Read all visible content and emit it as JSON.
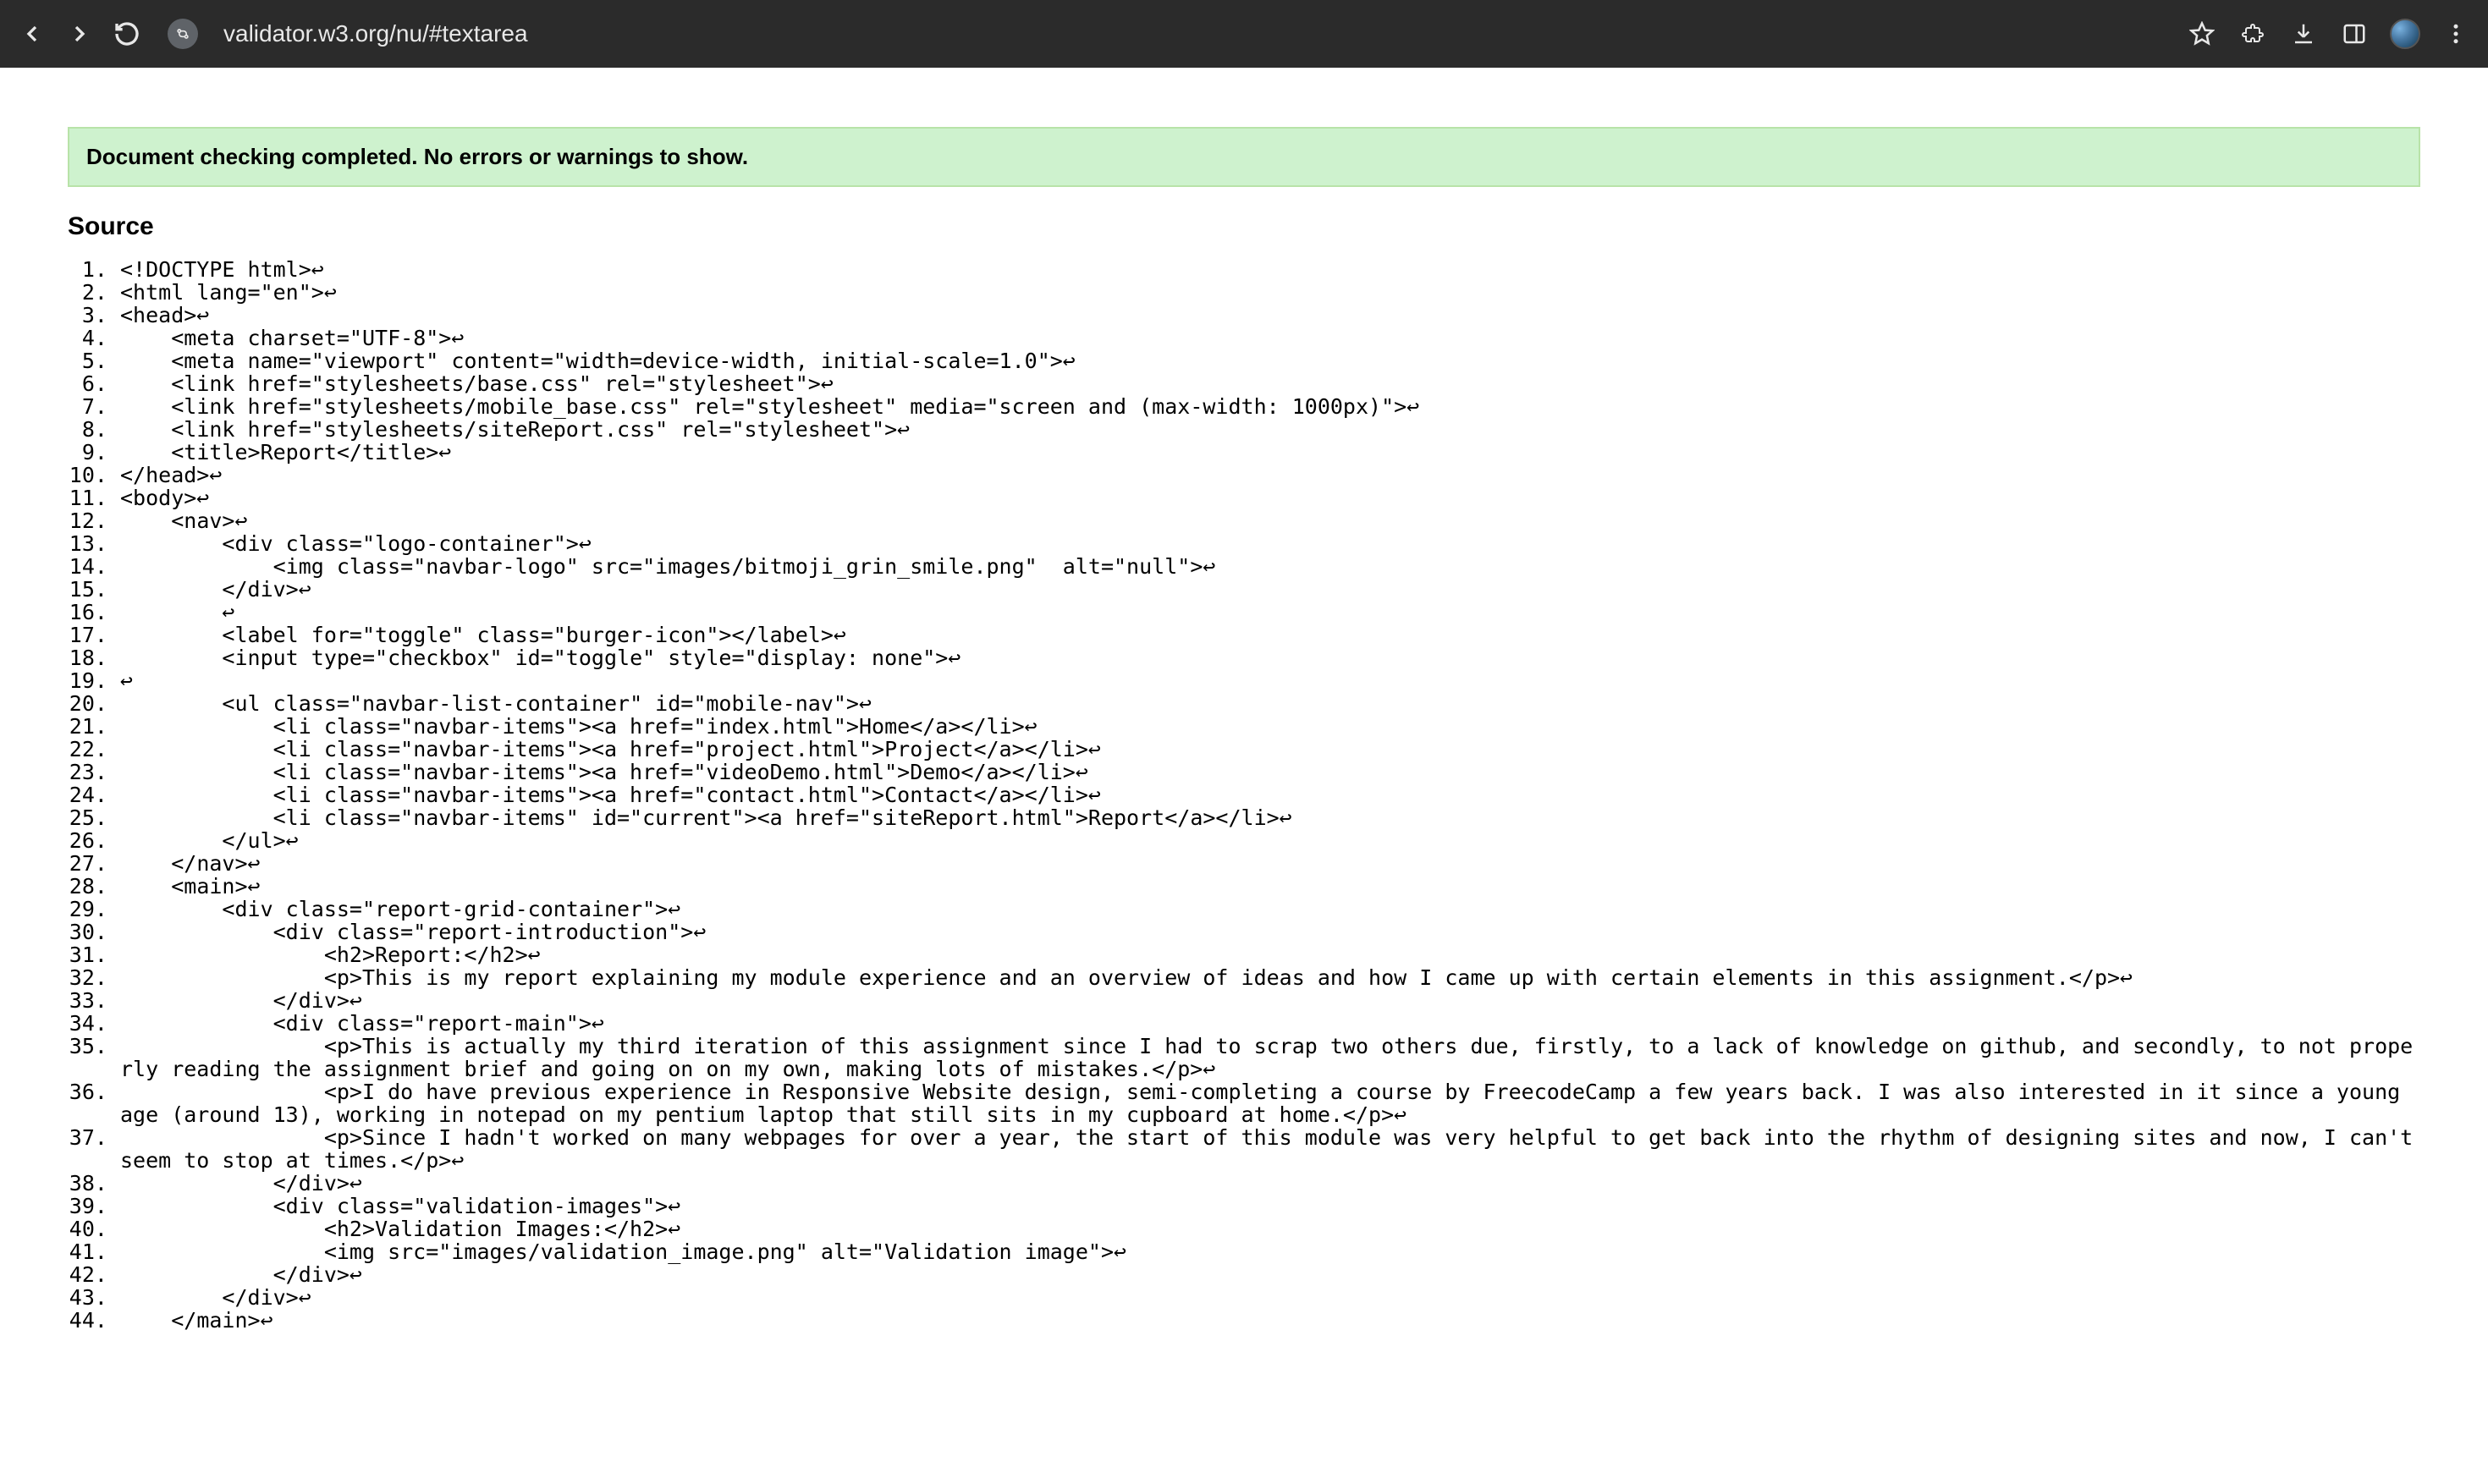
{
  "browser": {
    "url": "validator.w3.org/nu/#textarea"
  },
  "validator": {
    "success_message": "Document checking completed. No errors or warnings to show.",
    "source_heading": "Source",
    "source_lines": [
      "<!DOCTYPE html>↩",
      "<html lang=\"en\">↩",
      "<head>↩",
      "    <meta charset=\"UTF-8\">↩",
      "    <meta name=\"viewport\" content=\"width=device-width, initial-scale=1.0\">↩",
      "    <link href=\"stylesheets/base.css\" rel=\"stylesheet\">↩",
      "    <link href=\"stylesheets/mobile_base.css\" rel=\"stylesheet\" media=\"screen and (max-width: 1000px)\">↩",
      "    <link href=\"stylesheets/siteReport.css\" rel=\"stylesheet\">↩",
      "    <title>Report</title>↩",
      "</head>↩",
      "<body>↩",
      "    <nav>↩",
      "        <div class=\"logo-container\">↩",
      "            <img class=\"navbar-logo\" src=\"images/bitmoji_grin_smile.png\"  alt=\"null\">↩",
      "        </div>↩",
      "        ↩",
      "        <label for=\"toggle\" class=\"burger-icon\"></label>↩",
      "        <input type=\"checkbox\" id=\"toggle\" style=\"display: none\">↩",
      "↩",
      "        <ul class=\"navbar-list-container\" id=\"mobile-nav\">↩",
      "            <li class=\"navbar-items\"><a href=\"index.html\">Home</a></li>↩",
      "            <li class=\"navbar-items\"><a href=\"project.html\">Project</a></li>↩",
      "            <li class=\"navbar-items\"><a href=\"videoDemo.html\">Demo</a></li>↩",
      "            <li class=\"navbar-items\"><a href=\"contact.html\">Contact</a></li>↩",
      "            <li class=\"navbar-items\" id=\"current\"><a href=\"siteReport.html\">Report</a></li>↩",
      "        </ul>↩",
      "    </nav>↩",
      "    <main>↩",
      "        <div class=\"report-grid-container\">↩",
      "            <div class=\"report-introduction\">↩",
      "                <h2>Report:</h2>↩",
      "                <p>This is my report explaining my module experience and an overview of ideas and how I came up with certain elements in this assignment.</p>↩",
      "            </div>↩",
      "            <div class=\"report-main\">↩",
      "                <p>This is actually my third iteration of this assignment since I had to scrap two others due, firstly, to a lack of knowledge on github, and secondly, to not properly reading the assignment brief and going on on my own, making lots of mistakes.</p>↩",
      "                <p>I do have previous experience in Responsive Website design, semi-completing a course by FreecodeCamp a few years back. I was also interested in it since a young age (around 13), working in notepad on my pentium laptop that still sits in my cupboard at home.</p>↩",
      "                <p>Since I hadn't worked on many webpages for over a year, the start of this module was very helpful to get back into the rhythm of designing sites and now, I can't seem to stop at times.</p>↩",
      "            </div>↩",
      "            <div class=\"validation-images\">↩",
      "                <h2>Validation Images:</h2>↩",
      "                <img src=\"images/validation_image.png\" alt=\"Validation image\">↩",
      "            </div>↩",
      "        </div>↩",
      "    </main>↩"
    ]
  }
}
